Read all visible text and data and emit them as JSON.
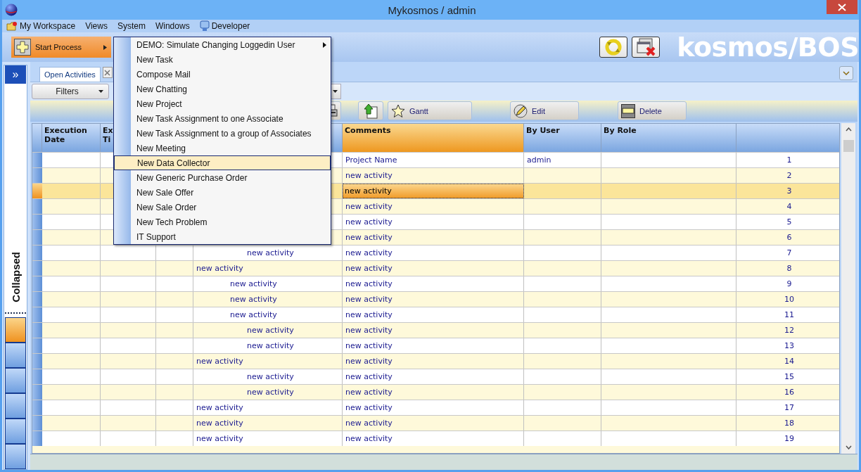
{
  "window": {
    "title": "Mykosmos / admin"
  },
  "menu_bar": [
    {
      "label": "My Workspace",
      "kind": "workspace"
    },
    {
      "label": "Views",
      "kind": "plain"
    },
    {
      "label": "System",
      "kind": "plain"
    },
    {
      "label": "Windows",
      "kind": "plain"
    },
    {
      "label": "Developer",
      "kind": "developer"
    }
  ],
  "toolbar": {
    "start_button": "Start Process",
    "brand": "kosmos/BOS"
  },
  "side_panel": {
    "expand_button": "»",
    "caption": "Collapsed",
    "tiles": [
      {
        "selected": true
      },
      {
        "selected": false
      },
      {
        "selected": false
      },
      {
        "selected": false
      },
      {
        "selected": false
      },
      {
        "selected": false
      }
    ]
  },
  "tabs": [
    {
      "label": "Open Activities"
    }
  ],
  "filter_bar": {
    "filters_button": "Filters"
  },
  "actions": [
    {
      "kind": "print"
    },
    {
      "kind": "upload"
    },
    {
      "kind": "gantt",
      "label": "Gantt"
    },
    {
      "kind": "edit",
      "label": "Edit"
    },
    {
      "kind": "delete",
      "label": "Delete"
    }
  ],
  "table": {
    "columns": [
      {
        "lines": [
          "Execution",
          "Date"
        ],
        "selected": false
      },
      {
        "lines": [
          "Ex",
          "Ti"
        ],
        "selected": false
      },
      {},
      {},
      {
        "lines": [
          "Comments"
        ],
        "selected": true
      },
      {
        "lines": [
          "By User"
        ],
        "selected": false
      },
      {
        "lines": [
          "By Role"
        ],
        "selected": false
      },
      {}
    ],
    "rows": [
      {
        "selected": false,
        "comments": "Project Name",
        "by_user": "admin",
        "column_8": "1"
      },
      {
        "selected": false,
        "comments": "new activity",
        "column_8": "2"
      },
      {
        "selected": true,
        "comments": "new activity",
        "column_8": "3"
      },
      {
        "selected": false,
        "comments": "new activity",
        "column_8": "4"
      },
      {
        "selected": false,
        "comments": "new activity",
        "column_8": "5"
      },
      {
        "selected": false,
        "comments": "new activity",
        "column_8": "6"
      },
      {
        "selected": false,
        "column_4": "new activity",
        "kind": "deep",
        "comments": "new activity",
        "column_8": "7"
      },
      {
        "selected": false,
        "column_4": "new activity",
        "kind": "top",
        "comments": "new activity",
        "column_8": "8"
      },
      {
        "selected": false,
        "column_4": "new activity",
        "kind": "sub",
        "comments": "new activity",
        "column_8": "9"
      },
      {
        "selected": false,
        "column_4": "new activity",
        "kind": "sub",
        "comments": "new activity",
        "column_8": "10"
      },
      {
        "selected": false,
        "column_4": "new activity",
        "kind": "sub",
        "comments": "new activity",
        "column_8": "11"
      },
      {
        "selected": false,
        "column_4": "new activity",
        "kind": "deep",
        "comments": "new activity",
        "column_8": "12"
      },
      {
        "selected": false,
        "column_4": "new activity",
        "kind": "deep",
        "comments": "new activity",
        "column_8": "13"
      },
      {
        "selected": false,
        "column_4": "new activity",
        "kind": "top",
        "comments": "new activity",
        "column_8": "14"
      },
      {
        "selected": false,
        "column_4": "new activity",
        "kind": "deep",
        "comments": "new activity",
        "column_8": "15"
      },
      {
        "selected": false,
        "column_4": "new activity",
        "kind": "deep",
        "comments": "new activity",
        "column_8": "16"
      },
      {
        "selected": false,
        "column_4": "new activity",
        "kind": "top",
        "comments": "new activity",
        "column_8": "17"
      },
      {
        "selected": false,
        "column_4": "new activity",
        "kind": "top",
        "comments": "new activity",
        "column_8": "18"
      },
      {
        "selected": false,
        "column_4": "new activity",
        "kind": "top",
        "comments": "new activity",
        "column_8": "19"
      }
    ]
  },
  "popup_menu": {
    "items": [
      {
        "label": "DEMO: Simulate Changing Loggedin User",
        "selected": false,
        "submenu": true
      },
      {
        "label": "New Task",
        "selected": false,
        "submenu": false
      },
      {
        "label": "Compose Mail",
        "selected": false,
        "submenu": false
      },
      {
        "label": "New Chatting",
        "selected": false,
        "submenu": false
      },
      {
        "label": "New Project",
        "selected": false,
        "submenu": false
      },
      {
        "label": "New Task Assignment to one Associate",
        "selected": false,
        "submenu": false
      },
      {
        "label": "New Task Assignment to a group of Associates",
        "selected": false,
        "submenu": false
      },
      {
        "label": "New Meeting",
        "selected": false,
        "submenu": false
      },
      {
        "label": "New Data Collector",
        "selected": true,
        "submenu": false
      },
      {
        "label": "New Generic Purchase Order",
        "selected": false,
        "submenu": false
      },
      {
        "label": "New Sale Offer",
        "selected": false,
        "submenu": false
      },
      {
        "label": "New Sale Order",
        "selected": false,
        "submenu": false
      },
      {
        "label": "New Tech Problem",
        "selected": false,
        "submenu": false
      },
      {
        "label": "IT Support",
        "selected": false,
        "submenu": false
      }
    ]
  }
}
